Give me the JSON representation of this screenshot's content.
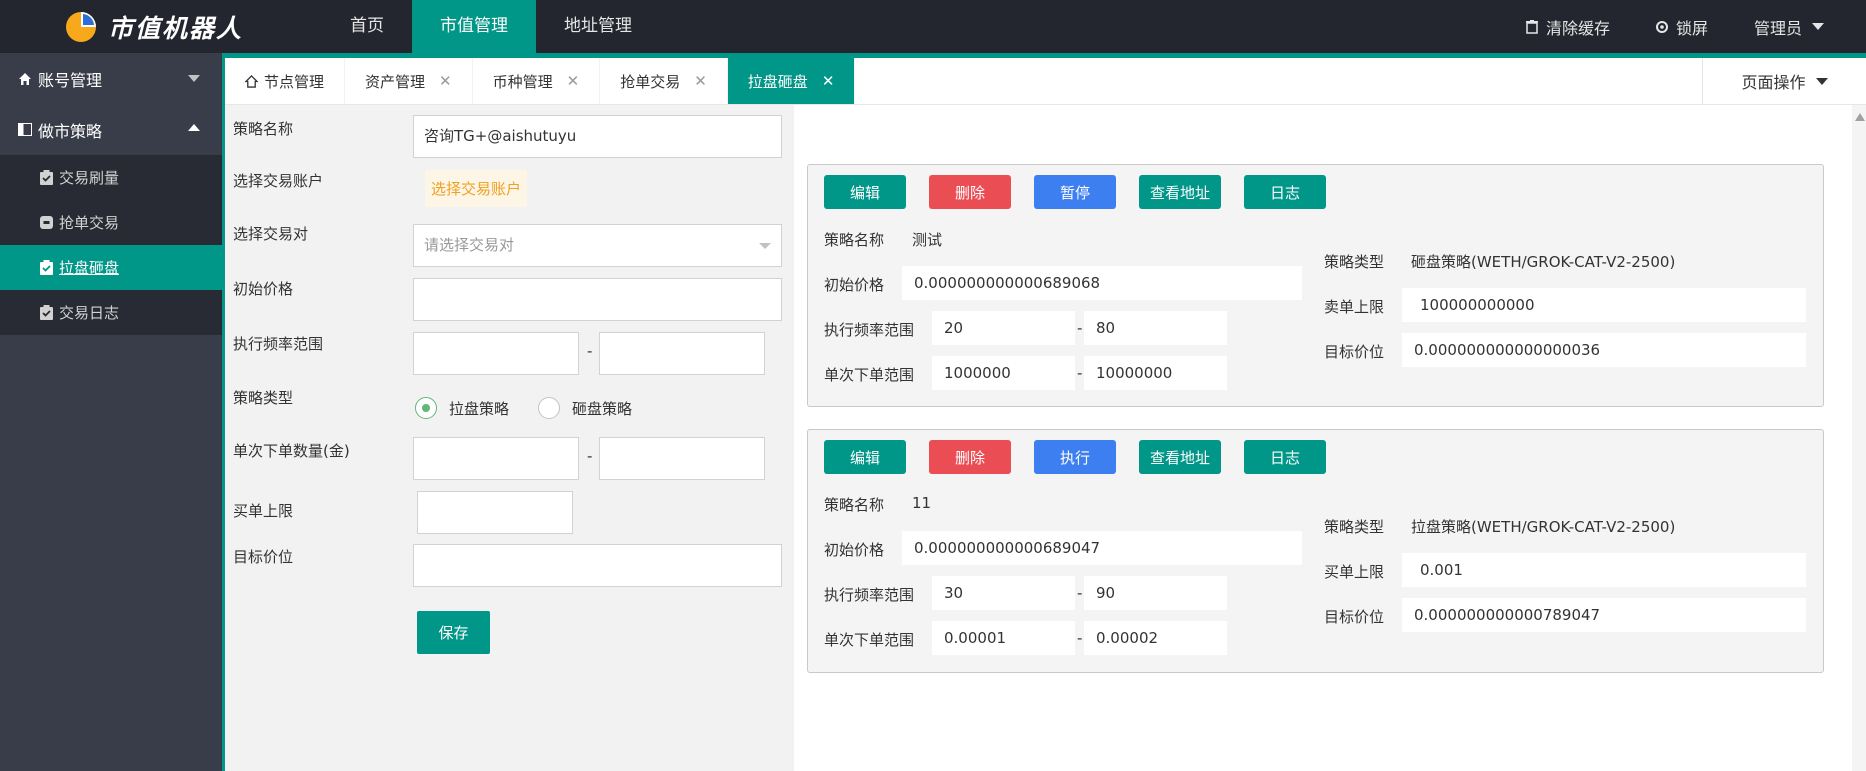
{
  "header": {
    "logo_text": "市值机器人",
    "nav": [
      {
        "label": "首页"
      },
      {
        "label": "市值管理"
      },
      {
        "label": "地址管理"
      }
    ],
    "clear_cache": "清除缓存",
    "lock_screen": "锁屏",
    "admin": "管理员"
  },
  "sidebar": {
    "groups": [
      {
        "label": "账号管理",
        "expanded": false
      },
      {
        "label": "做市策略",
        "expanded": true
      }
    ],
    "items": [
      {
        "label": "交易刷量"
      },
      {
        "label": "抢单交易"
      },
      {
        "label": "拉盘砸盘"
      },
      {
        "label": "交易日志"
      }
    ]
  },
  "tabs": {
    "items": [
      {
        "label": "节点管理"
      },
      {
        "label": "资产管理",
        "close": "✕"
      },
      {
        "label": "币种管理",
        "close": "✕"
      },
      {
        "label": "抢单交易",
        "close": "✕"
      },
      {
        "label": "拉盘砸盘",
        "close": "✕"
      }
    ],
    "page_op": "页面操作"
  },
  "form": {
    "name_label": "策略名称",
    "name_value": "咨询TG+@aishutuyu",
    "account_label": "选择交易账户",
    "account_button": "选择交易账户",
    "pair_label": "选择交易对",
    "pair_placeholder": "请选择交易对",
    "init_price_label": "初始价格",
    "freq_label": "执行频率范围",
    "type_label": "策略类型",
    "type_options": [
      "拉盘策略",
      "砸盘策略"
    ],
    "amount_label": "单次下单数量(金)",
    "buy_limit_label": "买单上限",
    "target_label": "目标价位",
    "dash": "-",
    "save": "保存"
  },
  "cards": [
    {
      "buttons": [
        "编辑",
        "删除",
        "暂停",
        "查看地址",
        "日志"
      ],
      "name_label": "策略名称",
      "name": "测试",
      "init_label": "初始价格",
      "init": "0.000000000000689068",
      "freq_label": "执行频率范围",
      "freq_min": "20",
      "freq_max": "80",
      "amount_label": "单次下单范围",
      "amount_min": "1000000",
      "amount_max": "10000000",
      "type_label": "策略类型",
      "type": "砸盘策略(WETH/GROK-CAT-V2-2500)",
      "limit_label": "卖单上限",
      "limit": "100000000000",
      "target_label": "目标价位",
      "target": "0.000000000000000036"
    },
    {
      "buttons": [
        "编辑",
        "删除",
        "执行",
        "查看地址",
        "日志"
      ],
      "name_label": "策略名称",
      "name": "11",
      "init_label": "初始价格",
      "init": "0.000000000000689047",
      "freq_label": "执行频率范围",
      "freq_min": "30",
      "freq_max": "90",
      "amount_label": "单次下单范围",
      "amount_min": "0.00001",
      "amount_max": "0.00002",
      "type_label": "策略类型",
      "type": "拉盘策略(WETH/GROK-CAT-V2-2500)",
      "limit_label": "买单上限",
      "limit": "0.001",
      "target_label": "目标价位",
      "target": "0.000000000000789047"
    }
  ],
  "colors": {
    "accent": "#009688",
    "header_bg": "#23262e",
    "sidebar_bg": "#393d49",
    "danger": "#eb4d55",
    "primary": "#3d7ff0"
  }
}
